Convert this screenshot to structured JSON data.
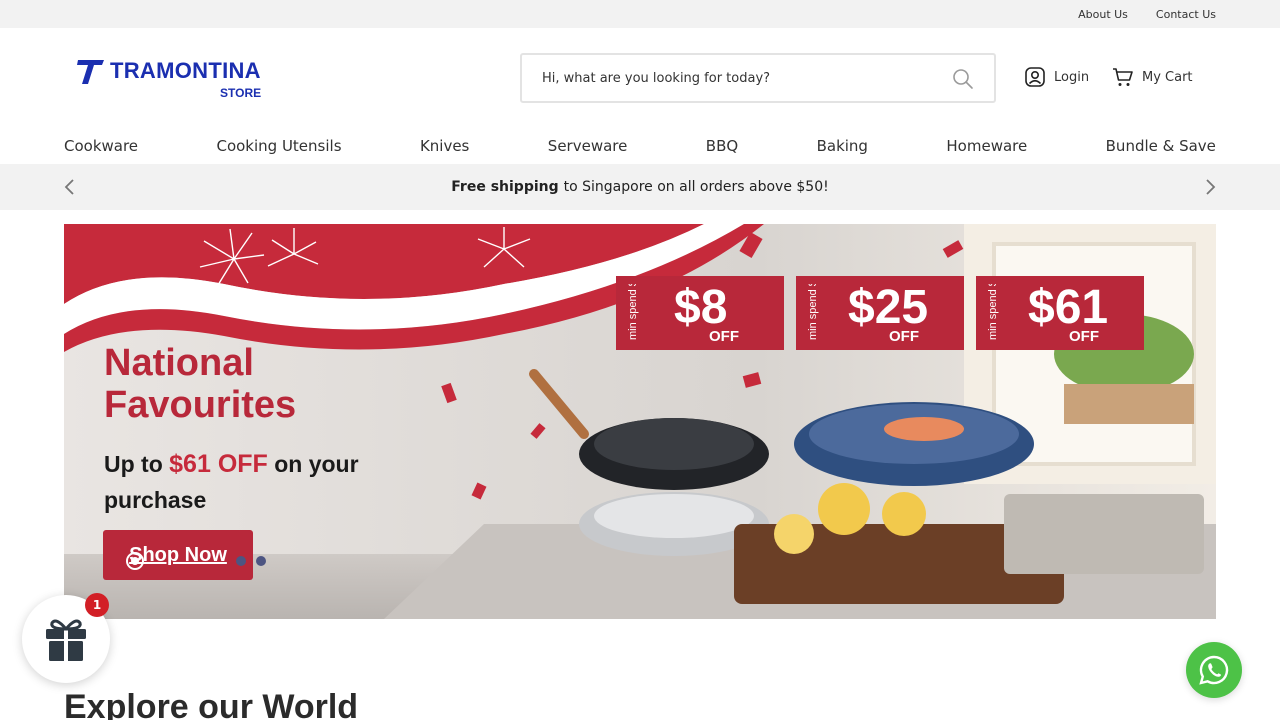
{
  "topbar": {
    "about": "About Us",
    "contact": "Contact Us"
  },
  "logo": {
    "brand": "TRAMONTINA",
    "store": "STORE"
  },
  "search": {
    "placeholder": "Hi, what are you looking for today?",
    "icon": "search-icon"
  },
  "header": {
    "login": "Login",
    "cart": "My Cart"
  },
  "nav": [
    "Cookware",
    "Cooking Utensils",
    "Knives",
    "Serveware",
    "BBQ",
    "Baking",
    "Homeware",
    "Bundle & Save"
  ],
  "promo": {
    "bold": "Free shipping",
    "text": "to Singapore on all orders above $50!"
  },
  "banner": {
    "headline_1": "National",
    "headline_2": "Favourites",
    "sub_1": "Up to",
    "sub_hl": "$61 OFF",
    "sub_2": "on your purchase",
    "cta": "Shop Now",
    "coupons": [
      {
        "spend": "min spend $100",
        "amount": "$8",
        "off": "OFF"
      },
      {
        "spend": "min spend $250",
        "amount": "$25",
        "off": "OFF"
      },
      {
        "spend": "min spend $450",
        "amount": "$61",
        "off": "OFF"
      }
    ],
    "slides": 3,
    "active_slide": 1
  },
  "section": {
    "title": "Explore our World"
  },
  "gift_widget": {
    "badge": "1",
    "icon": "gift-icon"
  },
  "colors": {
    "brand": "#1b2fb0",
    "promo_red": "#b8283a",
    "whatsapp": "#4dc247",
    "badge": "#d21f26"
  }
}
